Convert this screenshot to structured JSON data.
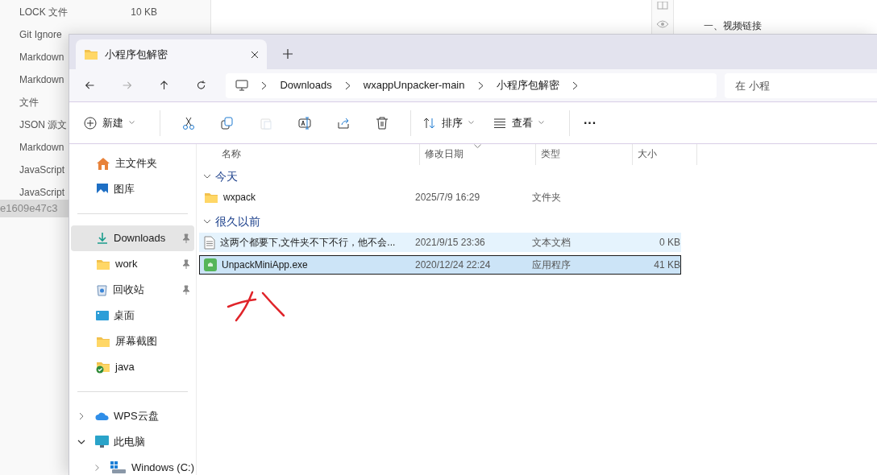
{
  "background_list": [
    {
      "type": "LOCK 文件",
      "size": "10 KB"
    },
    {
      "type": "Git Ignore"
    },
    {
      "type": "Markdown"
    },
    {
      "type": "Markdown"
    },
    {
      "type": "文件"
    },
    {
      "type": "JSON 源文"
    },
    {
      "type": "Markdown"
    },
    {
      "type": "JavaScript"
    },
    {
      "type": "JavaScript"
    }
  ],
  "background_hash": "e1609e47c3",
  "background_heading": "一、视频链接",
  "window": {
    "tabs": [
      {
        "title": "小程序包解密",
        "selected": true
      }
    ],
    "breadcrumbs": [
      "Downloads",
      "wxappUnpacker-main",
      "小程序包解密"
    ],
    "search": {
      "placeholder": "在 小程"
    },
    "toolbar": [
      {
        "kind": "menu",
        "label": "新建",
        "disabled": false
      },
      {
        "kind": "icon",
        "disabled": false
      },
      {
        "kind": "icon",
        "disabled": false
      },
      {
        "kind": "icon",
        "disabled": true
      },
      {
        "kind": "icon",
        "disabled": false
      },
      {
        "kind": "icon",
        "disabled": false
      },
      {
        "kind": "icon",
        "disabled": false
      },
      {
        "kind": "menu",
        "label": "排序",
        "disabled": false
      },
      {
        "kind": "menu",
        "label": "查看",
        "disabled": false
      },
      {
        "kind": "more",
        "label": "···",
        "disabled": false
      }
    ],
    "sidebar": [
      {
        "kind": "item",
        "label": "主文件夹",
        "selected": false,
        "pinned": false
      },
      {
        "kind": "item",
        "label": "图库",
        "selected": false,
        "pinned": false
      },
      {
        "kind": "divider"
      },
      {
        "kind": "item",
        "label": "Downloads",
        "selected": true,
        "pinned": true
      },
      {
        "kind": "item",
        "label": "work",
        "selected": false,
        "pinned": true
      },
      {
        "kind": "item",
        "label": "回收站",
        "selected": false,
        "pinned": true
      },
      {
        "kind": "item",
        "label": "桌面",
        "selected": false,
        "pinned": false
      },
      {
        "kind": "item",
        "label": "屏幕截图",
        "selected": false,
        "pinned": false
      },
      {
        "kind": "item",
        "label": "java",
        "selected": false,
        "pinned": false
      },
      {
        "kind": "divider"
      },
      {
        "kind": "tree",
        "label": "WPS云盘",
        "expanded": false,
        "selected": false
      },
      {
        "kind": "tree",
        "label": "此电脑",
        "expanded": true,
        "selected": false,
        "children": [
          {
            "kind": "tree",
            "label": "Windows (C:)",
            "expanded": false,
            "selected": false
          }
        ]
      }
    ],
    "columns": [
      "名称",
      "修改日期",
      "类型",
      "大小"
    ],
    "groups": [
      {
        "title": "今天",
        "expanded": true,
        "rows": [
          {
            "kind": "folder",
            "name": "wxpack",
            "date": "2025/7/9 16:29",
            "type": "文件夹",
            "selected": false,
            "hover": false
          }
        ]
      },
      {
        "title": "很久以前",
        "expanded": true,
        "rows": [
          {
            "kind": "text",
            "name": "这两个都要下,文件夹不下不行，他不会...",
            "date": "2021/9/15 23:36",
            "type": "文本文档",
            "size": "0 KB",
            "selected": false,
            "hover": true
          },
          {
            "kind": "app",
            "name": "UnpackMiniApp.exe",
            "date": "2020/12/24 22:24",
            "type": "应用程序",
            "size": "41 KB",
            "selected": true,
            "hover": false
          }
        ]
      }
    ]
  }
}
